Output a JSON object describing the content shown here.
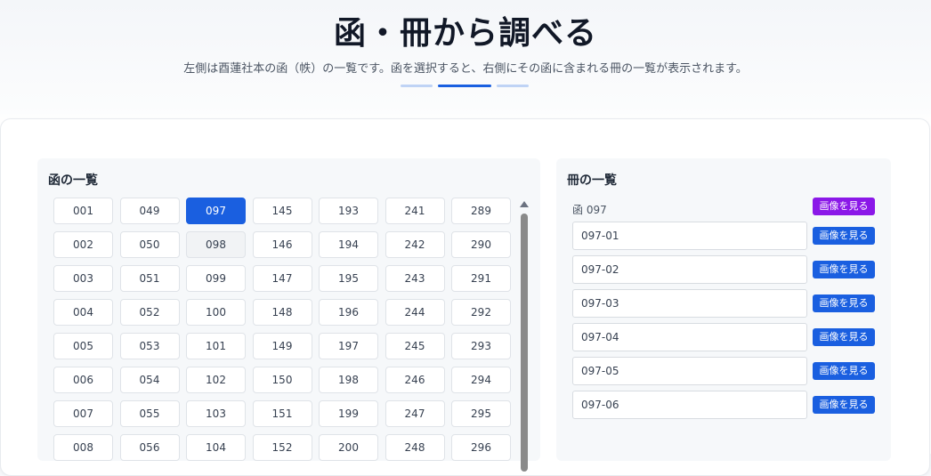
{
  "header": {
    "title": "函・冊から調べる",
    "subtitle": "左側は酉蓮社本の函（帙）の一覧です。函を選択すると、右側にその函に含まれる冊の一覧が表示されます。",
    "steps_active_index": 1
  },
  "box_panel": {
    "title": "函の一覧",
    "columns": [
      [
        "001",
        "002",
        "003",
        "004",
        "005",
        "006",
        "007",
        "008"
      ],
      [
        "049",
        "050",
        "051",
        "052",
        "053",
        "054",
        "055",
        "056"
      ],
      [
        "097",
        "098",
        "099",
        "100",
        "101",
        "102",
        "103",
        "104"
      ],
      [
        "145",
        "146",
        "147",
        "148",
        "149",
        "150",
        "151",
        "152"
      ],
      [
        "193",
        "194",
        "195",
        "196",
        "197",
        "198",
        "199",
        "200"
      ],
      [
        "241",
        "242",
        "243",
        "244",
        "245",
        "246",
        "247",
        "248"
      ],
      [
        "289",
        "290",
        "291",
        "292",
        "293",
        "294",
        "295",
        "296"
      ]
    ],
    "selected": "097",
    "hovered": "098"
  },
  "volume_panel": {
    "title": "冊の一覧",
    "box_label": "函 097",
    "view_label": "画像を見る",
    "volumes": [
      "097-01",
      "097-02",
      "097-03",
      "097-04",
      "097-05",
      "097-06"
    ]
  },
  "colors": {
    "accent": "#1a5fe0",
    "purple": "#8b18e8",
    "step_inactive": "#bfd3f5"
  }
}
